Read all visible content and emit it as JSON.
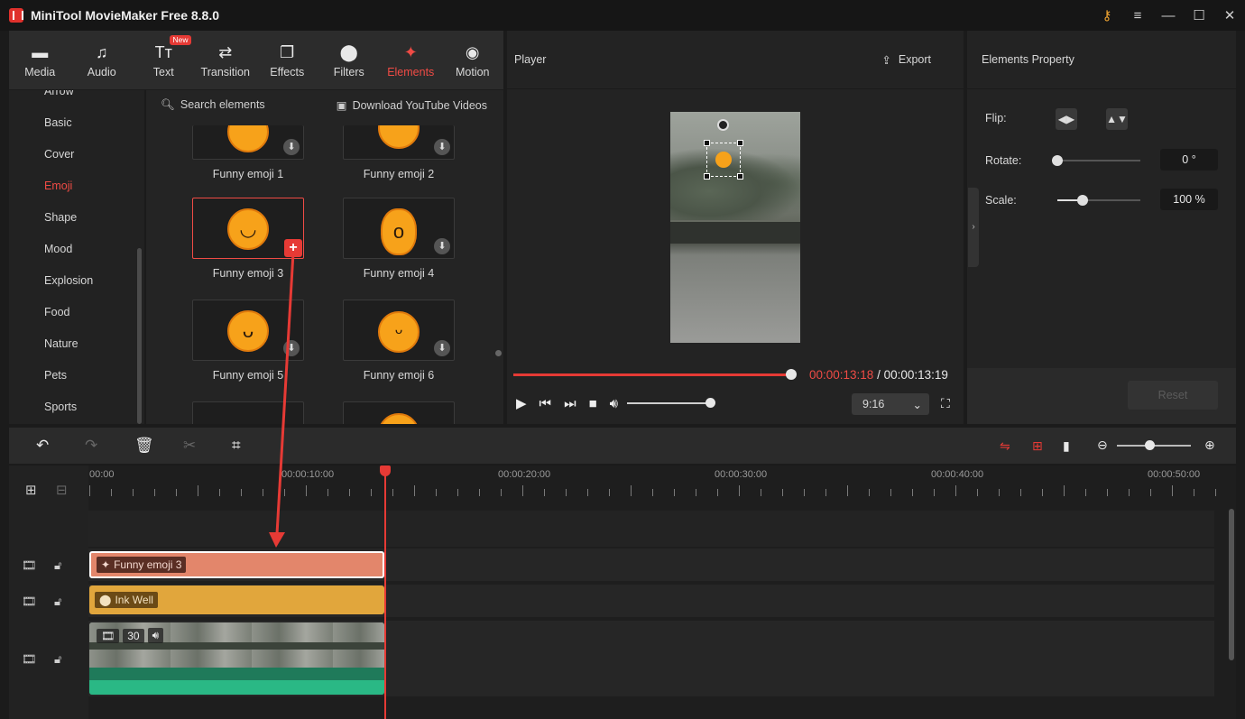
{
  "app": {
    "title": "MiniTool MovieMaker Free 8.8.0"
  },
  "tabs": [
    {
      "label": "Media",
      "icon": "folder-icon",
      "glyph": "▬"
    },
    {
      "label": "Audio",
      "icon": "music-note-icon",
      "glyph": "♫"
    },
    {
      "label": "Text",
      "icon": "text-icon",
      "glyph": "Tт",
      "badge": "New"
    },
    {
      "label": "Transition",
      "icon": "transition-icon",
      "glyph": "⇄"
    },
    {
      "label": "Effects",
      "icon": "effects-icon",
      "glyph": "❐"
    },
    {
      "label": "Filters",
      "icon": "filters-icon",
      "glyph": "⬤"
    },
    {
      "label": "Elements",
      "icon": "elements-icon",
      "glyph": "✦",
      "active": true
    },
    {
      "label": "Motion",
      "icon": "motion-icon",
      "glyph": "◉"
    }
  ],
  "categories": [
    "Arrow",
    "Basic",
    "Cover",
    "Emoji",
    "Shape",
    "Mood",
    "Explosion",
    "Food",
    "Nature",
    "Pets",
    "Sports"
  ],
  "active_category": "Emoji",
  "elements": {
    "search_label": "Search elements",
    "download_label": "Download YouTube Videos",
    "items": [
      {
        "label": "Funny emoji 1"
      },
      {
        "label": "Funny emoji 2"
      },
      {
        "label": "Funny emoji 3",
        "selected": true
      },
      {
        "label": "Funny emoji 4"
      },
      {
        "label": "Funny emoji 5"
      },
      {
        "label": "Funny emoji 6"
      }
    ]
  },
  "player": {
    "title": "Player",
    "export_label": "Export",
    "current_time": "00:00:13:18",
    "separator": " / ",
    "total_time": "00:00:13:19",
    "aspect_ratio": "9:16",
    "progress": 0.98,
    "volume": 1.0
  },
  "properties": {
    "title": "Elements Property",
    "flip_label": "Flip:",
    "rotate_label": "Rotate:",
    "rotate_value": "0 °",
    "rotate_fraction": 0.0,
    "scale_label": "Scale:",
    "scale_value": "100 %",
    "scale_fraction": 0.3,
    "reset_label": "Reset"
  },
  "timeline": {
    "ruler": [
      "00:00",
      "00:00:10:00",
      "00:00:20:00",
      "00:00:30:00",
      "00:00:40:00",
      "00:00:50:00"
    ],
    "zoom_level": 0.45,
    "clips": {
      "emoji": "Funny emoji 3",
      "filter": "Ink Well",
      "video_count": "30"
    }
  },
  "colors": {
    "accent": "#e63a35",
    "emoji_clip": "#e3866b",
    "filter_clip": "#e1a63c",
    "audio": "#2ab885"
  }
}
